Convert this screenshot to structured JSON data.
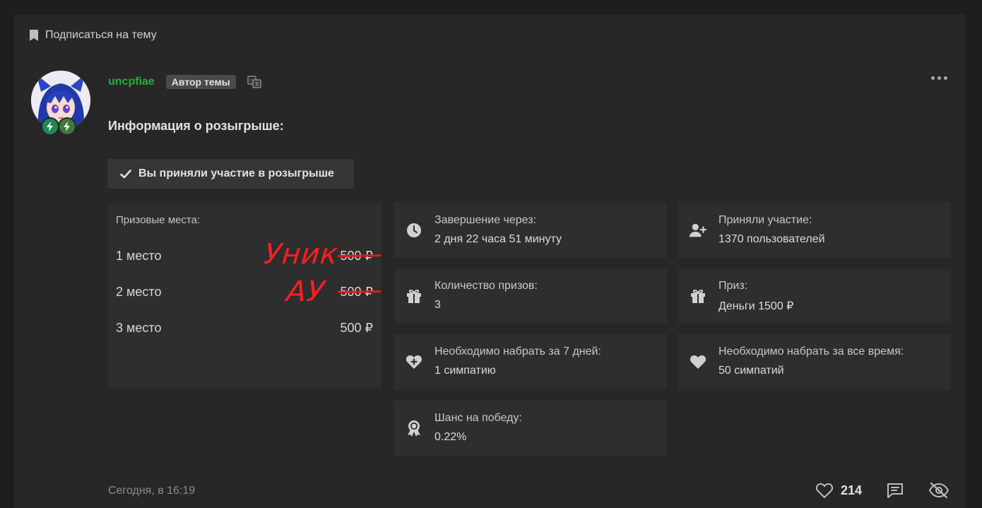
{
  "thread": {
    "subscribe_label": "Подписаться на тему"
  },
  "post": {
    "username": "uncpfiae",
    "author_tag": "Автор темы",
    "title": "Информация о розыгрыше:",
    "participated_label": "Вы приняли участие в розыгрыше",
    "timestamp": "Сегодня, в 16:19",
    "likes": "214"
  },
  "prizes": {
    "header": "Призовые места:",
    "rows": [
      {
        "place": "1 место",
        "amount": "500 ₽",
        "crossed": true,
        "note": "Уник"
      },
      {
        "place": "2 место",
        "amount": "500 ₽",
        "crossed": true,
        "note": "АУ"
      },
      {
        "place": "3 место",
        "amount": "500 ₽",
        "crossed": false,
        "note": ""
      }
    ]
  },
  "stats": {
    "ends": {
      "label": "Завершение через:",
      "value": "2 дня 22 часа 51 минуту",
      "icon": "clock-icon"
    },
    "participants": {
      "label": "Приняли участие:",
      "value": "1370 пользователей",
      "icon": "user-plus-icon"
    },
    "prize_count": {
      "label": "Количество призов:",
      "value": "3",
      "icon": "gift-icon"
    },
    "prize": {
      "label": "Приз:",
      "value": "Деньги 1500 ₽",
      "icon": "gift-icon"
    },
    "likes_7d": {
      "label": "Необходимо набрать за 7 дней:",
      "value": "1 симпатию",
      "icon": "heart-plus-icon"
    },
    "likes_all": {
      "label": "Необходимо набрать за все время:",
      "value": "50 симпатий",
      "icon": "heart-icon"
    },
    "chance": {
      "label": "Шанс на победу:",
      "value": "0.22%",
      "icon": "award-icon"
    }
  },
  "colors": {
    "username": "#1fb13c",
    "annotation": "#ff1f1f",
    "background": "#1e1e1e",
    "panel": "#272727"
  }
}
